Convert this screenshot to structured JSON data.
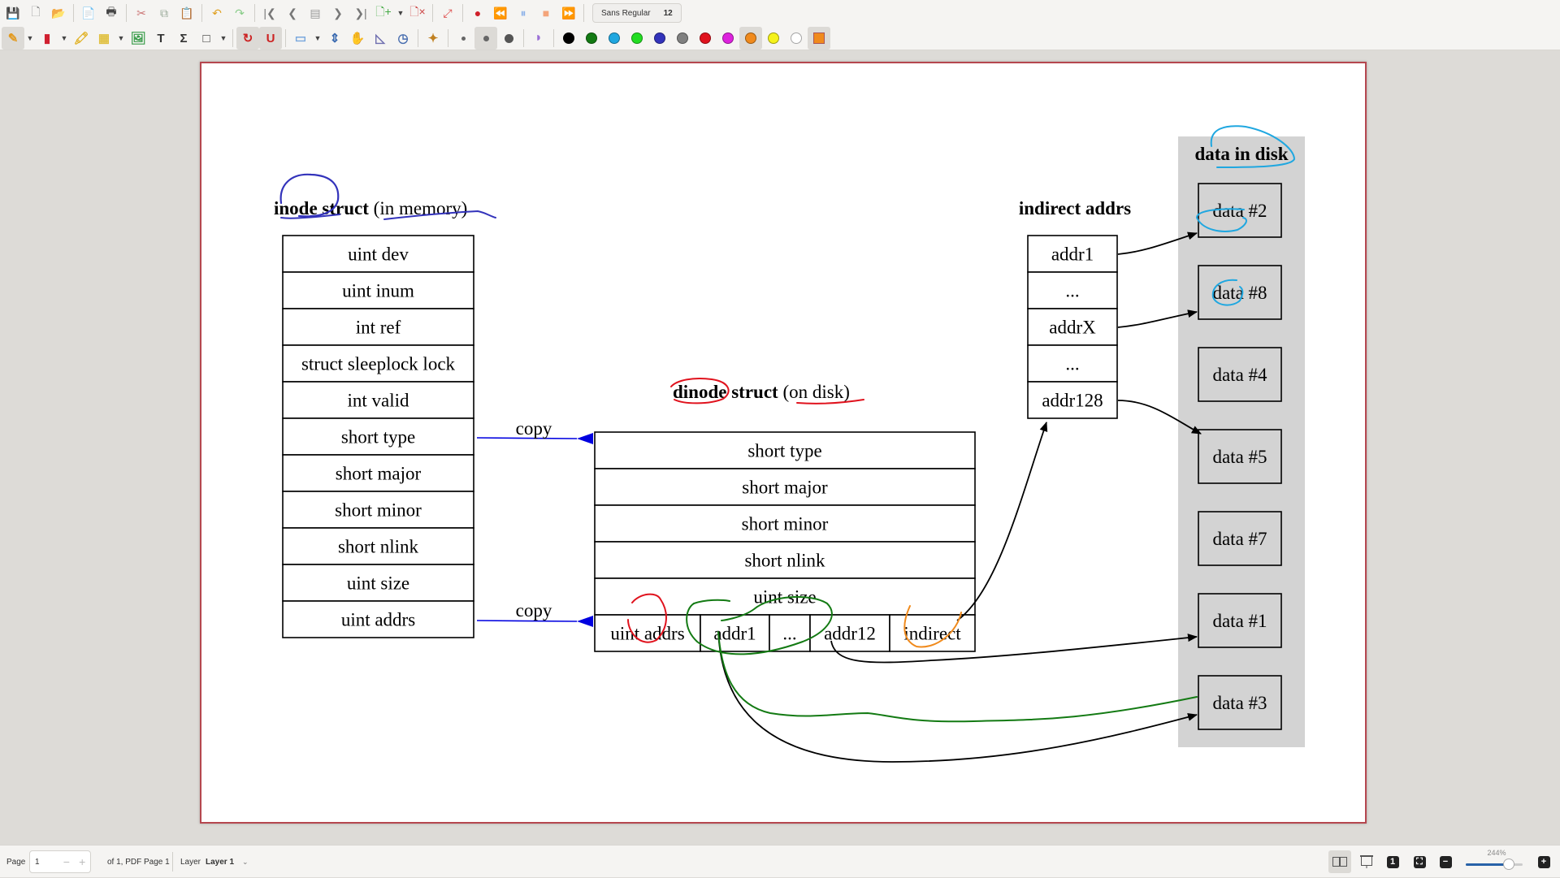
{
  "toolbar": {
    "row1": [
      {
        "name": "save-icon",
        "glyph": "💾"
      },
      {
        "name": "new-page-icon",
        "glyph": "🗋"
      },
      {
        "name": "open-folder-icon",
        "glyph": "📂"
      },
      {
        "name": "export-pdf-icon",
        "glyph": "📄"
      },
      {
        "name": "print-icon",
        "glyph": "🖶"
      },
      {
        "name": "cut-icon",
        "glyph": "✂"
      },
      {
        "name": "copy-icon",
        "glyph": "⧉"
      },
      {
        "name": "paste-icon",
        "glyph": "📋"
      },
      {
        "name": "undo-icon",
        "glyph": "↶"
      },
      {
        "name": "redo-icon",
        "glyph": "↷"
      },
      {
        "name": "first-page-icon",
        "glyph": "|❮"
      },
      {
        "name": "previous-page-icon",
        "glyph": "❮"
      },
      {
        "name": "goto-page-icon",
        "glyph": "▤"
      },
      {
        "name": "next-page-icon",
        "glyph": "❯"
      },
      {
        "name": "last-page-icon",
        "glyph": "❯|"
      },
      {
        "name": "add-page-icon",
        "glyph": "🗋+"
      },
      {
        "name": "delete-page-icon",
        "glyph": "🗋×"
      },
      {
        "name": "fullscreen-icon",
        "glyph": "⤢"
      },
      {
        "name": "record-icon",
        "glyph": "●"
      },
      {
        "name": "rewind-icon",
        "glyph": "⏪"
      },
      {
        "name": "pause-icon",
        "glyph": "⏸"
      },
      {
        "name": "stop-icon",
        "glyph": "■"
      },
      {
        "name": "fast-forward-icon",
        "glyph": "⏩"
      }
    ],
    "font": {
      "family": "Sans Regular",
      "size": "12"
    },
    "row2": [
      {
        "name": "pen-tool-icon",
        "glyph": "✎"
      },
      {
        "name": "eraser-tool-icon",
        "glyph": "▮"
      },
      {
        "name": "highlighter-tool-icon",
        "glyph": "🖍"
      },
      {
        "name": "select-region-tool-icon",
        "glyph": "▦"
      },
      {
        "name": "insert-image-icon",
        "glyph": "🖼"
      },
      {
        "name": "text-tool-icon",
        "glyph": "T"
      },
      {
        "name": "latex-tool-icon",
        "glyph": "Σ"
      },
      {
        "name": "shape-tool-icon",
        "glyph": "□"
      },
      {
        "name": "shape-recognizer-icon",
        "glyph": "↻"
      },
      {
        "name": "ruler-snap-icon",
        "glyph": "U"
      },
      {
        "name": "select-rect-icon",
        "glyph": "▭"
      },
      {
        "name": "vertical-space-icon",
        "glyph": "⇕"
      },
      {
        "name": "hand-tool-icon",
        "glyph": "✋"
      },
      {
        "name": "set-square-icon",
        "glyph": "◺"
      },
      {
        "name": "compass-icon",
        "glyph": "◷"
      },
      {
        "name": "default-tool-icon",
        "glyph": "✦"
      }
    ],
    "pen_sizes": [
      "fine",
      "medium",
      "thick"
    ],
    "colors": [
      "#000000",
      "#137a13",
      "#1fa7e0",
      "#22dd22",
      "#3333bb",
      "#808080",
      "#e0121d",
      "#dd22dd",
      "#f08a1c",
      "#f5f21a",
      "#ffffff"
    ],
    "selected_color": "#f08a1c"
  },
  "diagram": {
    "inode": {
      "title_bold": "inode struct",
      "title_normal": "(in memory)",
      "fields": [
        "uint dev",
        "uint inum",
        "int ref",
        "struct sleeplock lock",
        "int valid",
        "short type",
        "short major",
        "short minor",
        "short nlink",
        "uint size",
        "uint addrs"
      ]
    },
    "dinode": {
      "title_bold_1": "dinode",
      "title_bold_2": "struct",
      "title_normal": "(on disk)",
      "fields": [
        "short type",
        "short major",
        "short minor",
        "short nlink",
        "uint size"
      ],
      "addrs_row": [
        "uint addrs",
        "addr1",
        "...",
        "addr12",
        "indirect"
      ]
    },
    "copy_labels": [
      "copy",
      "copy"
    ],
    "indirect": {
      "title": "indirect addrs",
      "fields": [
        "addr1",
        "...",
        "addrX",
        "...",
        "addr128"
      ]
    },
    "disk": {
      "title": "data in disk",
      "blocks": [
        "data #2",
        "data #8",
        "data #4",
        "data #5",
        "data #7",
        "data #1",
        "data #3"
      ]
    }
  },
  "status": {
    "page_label": "Page",
    "page_value": "1",
    "page_of": "of 1, PDF Page 1",
    "layer_label": "Layer",
    "layer_value": "Layer 1",
    "zoom": "244%",
    "zoom_fraction": 0.75
  }
}
